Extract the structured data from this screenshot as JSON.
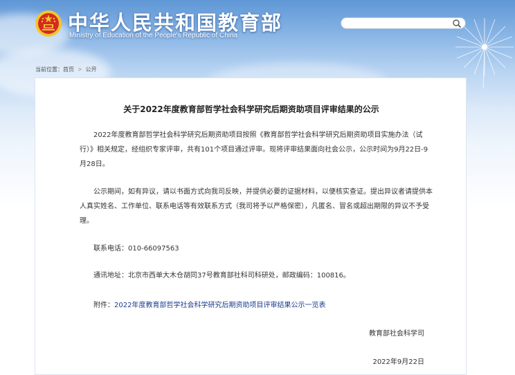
{
  "header": {
    "site_title": "中华人民共和国教育部",
    "site_subtitle": "Ministry of Education of the People's Republic of China",
    "search": {
      "value": "",
      "placeholder": ""
    }
  },
  "breadcrumb": {
    "prefix": "当前位置：",
    "home": "首页",
    "separator": ">",
    "current": "公开"
  },
  "article": {
    "title": "关于2022年度教育部哲学社会科学研究后期资助项目评审结果的公示",
    "paragraph1": "2022年度教育部哲学社会科学研究后期资助项目按照《教育部哲学社会科学研究后期资助项目实施办法（试行）》相关规定，经组织专家评审，共有101个项目通过评审。现将评审结果面向社会公示，公示时间为9月22日-9月28日。",
    "paragraph2": "公示期间，如有异议，请以书面方式向我司反映，并提供必要的证据材料，以便核实查证。提出异议者请提供本人真实姓名、工作单位、联系电话等有效联系方式（我司将予以严格保密），凡匿名、冒名或超出期限的异议不予受理。",
    "phone": "联系电话：010-66097563",
    "address": "通讯地址：北京市西单大木仓胡同37号教育部社科司科研处，邮政编码：100816。",
    "attachment_label": "附件：",
    "attachment_link": "2022年度教育部哲学社会科学研究后期资助项目评审结果公示一览表",
    "signature_org": "教育部社会科学司",
    "signature_date": "2022年9月22日"
  },
  "colors": {
    "link": "#1a3c8e",
    "sky_top": "#5f97d6",
    "emblem_red": "#d42a1f",
    "emblem_gold": "#f2c531"
  },
  "icons": [
    "national-emblem-icon",
    "search-icon"
  ]
}
